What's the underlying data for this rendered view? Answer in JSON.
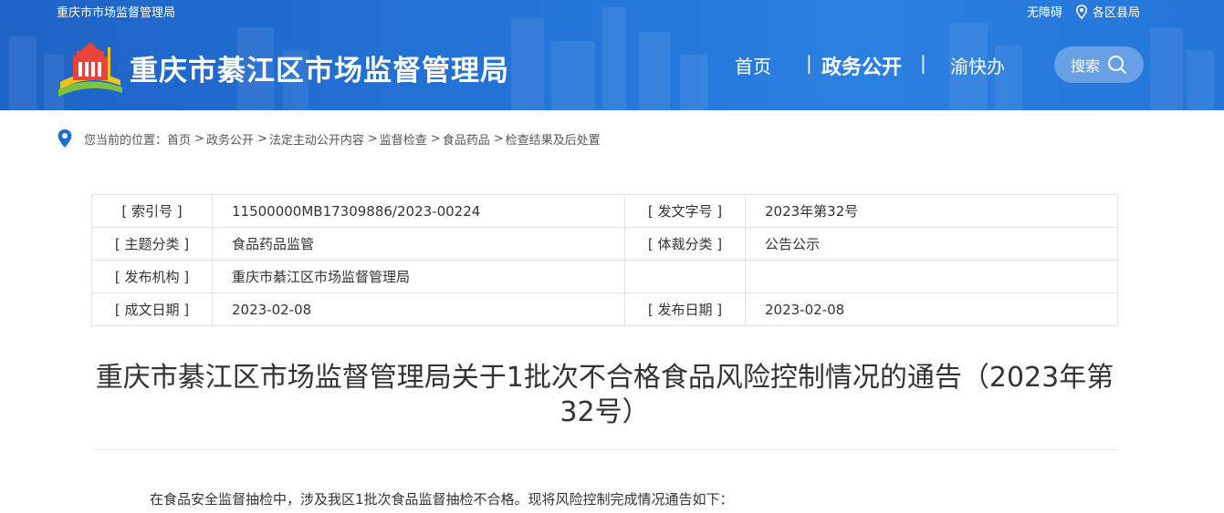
{
  "header": {
    "top_left": "重庆市市场监督管理局",
    "accessibility": "无障碍",
    "districts": "各区县局",
    "site_title": "重庆市綦江区市场监督管理局",
    "nav": {
      "home": "首页",
      "gov_affairs": "政务公开",
      "yukuaiban": "渝快办"
    },
    "search_label": "搜索"
  },
  "breadcrumb": {
    "prefix": "您当前的位置：",
    "items": [
      "首页",
      "政务公开",
      "法定主动公开内容",
      "监督检查",
      "食品药品",
      "检查结果及后处置"
    ],
    "separator": ">"
  },
  "meta": {
    "index_label": "[ 索引号 ]",
    "index_value": "11500000MB17309886/2023-00224",
    "doc_no_label": "[ 发文字号 ]",
    "doc_no_value": "2023年第32号",
    "topic_label": "[ 主题分类 ]",
    "topic_value": "食品药品监管",
    "genre_label": "[ 体裁分类 ]",
    "genre_value": "公告公示",
    "issuer_label": "[ 发布机构 ]",
    "issuer_value": "重庆市綦江区市场监督管理局",
    "created_label": "[ 成文日期 ]",
    "created_value": "2023-02-08",
    "published_label": "[ 发布日期 ]",
    "published_value": "2023-02-08"
  },
  "article": {
    "title_line1": "重庆市綦江区市场监督管理局关于1批次不合格食品风险控制情况的通告（2023年第",
    "title_line2": "32号）",
    "intro": "在食品安全监督抽检中，涉及我区1批次食品监督抽检不合格。现将风险控制完成情况通告如下："
  },
  "colors": {
    "header_blue": "#2373d6",
    "breadcrumb_pin": "#1a6fd1"
  }
}
